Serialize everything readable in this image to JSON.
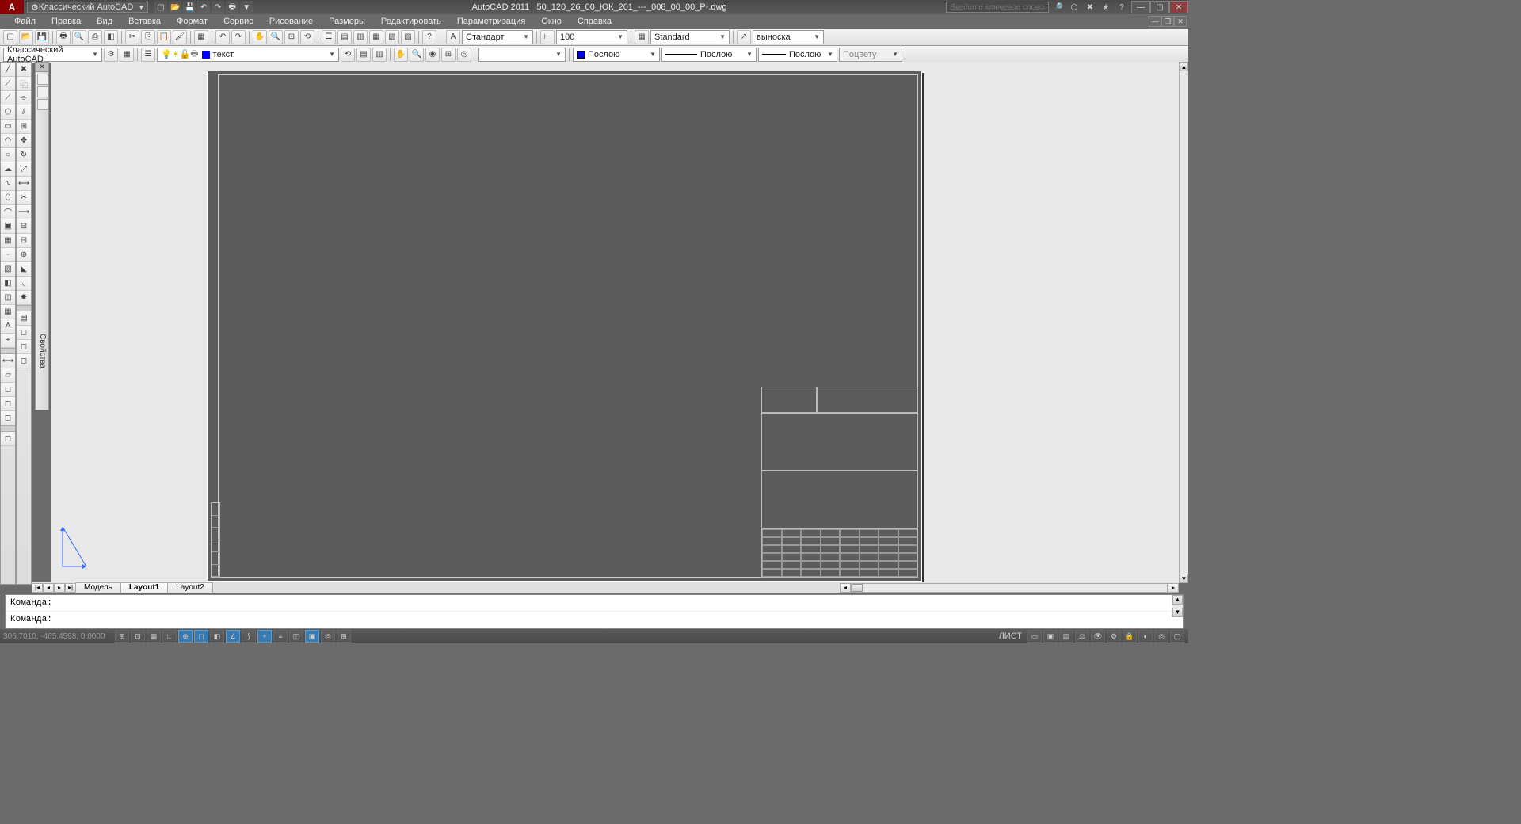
{
  "title": {
    "workspace_dropdown": "Классический AutoCAD",
    "app_name": "AutoCAD 2011",
    "file_name": "50_120_26_00_ЮК_201_---_008_00_00_Р-.dwg",
    "search_placeholder": "Введите ключевое слово/фразу"
  },
  "menu": {
    "items": [
      "Файл",
      "Правка",
      "Вид",
      "Вставка",
      "Формат",
      "Сервис",
      "Рисование",
      "Размеры",
      "Редактировать",
      "Параметризация",
      "Окно",
      "Справка"
    ]
  },
  "toolbar1": {
    "text_style_dd": "Стандарт",
    "dim_scale": "100",
    "dim_style_dd": "Standard",
    "mleader_dd": "выноска"
  },
  "toolbar2": {
    "ws_dd": "Классический AutoCAD",
    "layer_dd": "текст",
    "color_dd": "Послою",
    "ltype_dd": "Послою",
    "lweight_dd": "Послою",
    "plot_style_dd": "Поцвету"
  },
  "tabs": {
    "items": [
      "Модель",
      "Layout1",
      "Layout2"
    ],
    "active_index": 1
  },
  "cmd": {
    "prompt1": "Команда:",
    "prompt2": "Команда:"
  },
  "status": {
    "coords": "306.7010, -465.4598, 0.0000",
    "space_label": "ЛИСТ"
  },
  "props_tab_label": "Свойства"
}
